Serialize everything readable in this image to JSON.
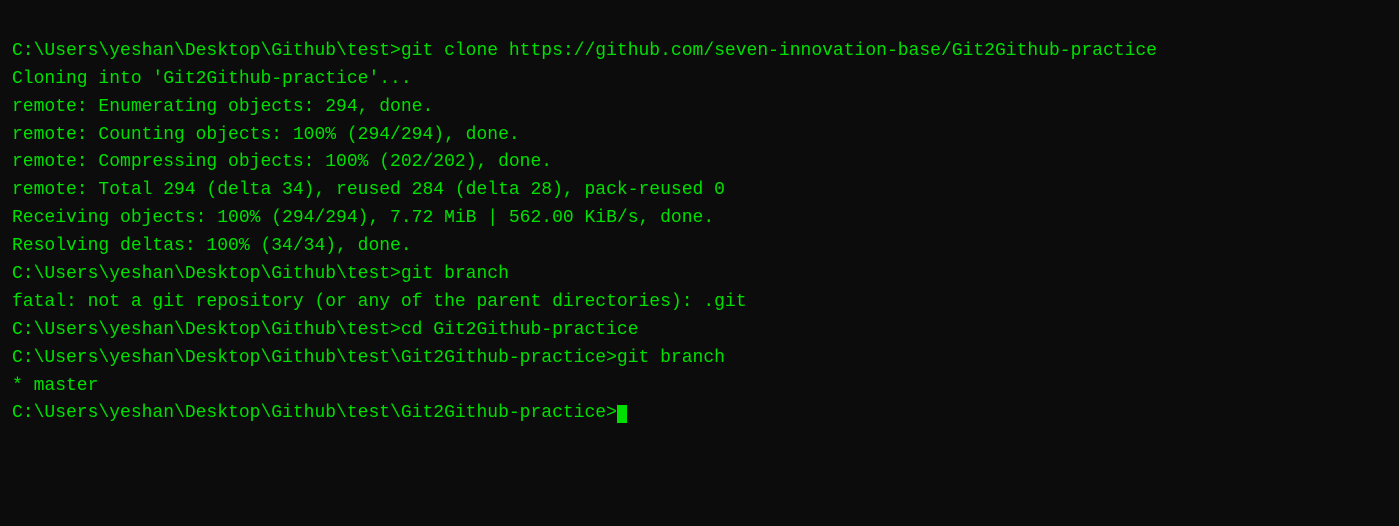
{
  "terminal": {
    "background": "#0c0c0c",
    "text_color": "#00e000",
    "lines": [
      "C:\\Users\\yeshan\\Desktop\\Github\\test>git clone https://github.com/seven-innovation-base/Git2Github-practice",
      "Cloning into 'Git2Github-practice'...",
      "remote: Enumerating objects: 294, done.",
      "remote: Counting objects: 100% (294/294), done.",
      "remote: Compressing objects: 100% (202/202), done.",
      "remote: Total 294 (delta 34), reused 284 (delta 28), pack-reused 0",
      "Receiving objects: 100% (294/294), 7.72 MiB | 562.00 KiB/s, done.",
      "Resolving deltas: 100% (34/34), done.",
      "",
      "C:\\Users\\yeshan\\Desktop\\Github\\test>git branch",
      "fatal: not a git repository (or any of the parent directories): .git",
      "",
      "C:\\Users\\yeshan\\Desktop\\Github\\test>cd Git2Github-practice",
      "",
      "C:\\Users\\yeshan\\Desktop\\Github\\test\\Git2Github-practice>git branch",
      "* master",
      "",
      "C:\\Users\\yeshan\\Desktop\\Github\\test\\Git2Github-practice>"
    ],
    "last_line_has_cursor": true
  }
}
